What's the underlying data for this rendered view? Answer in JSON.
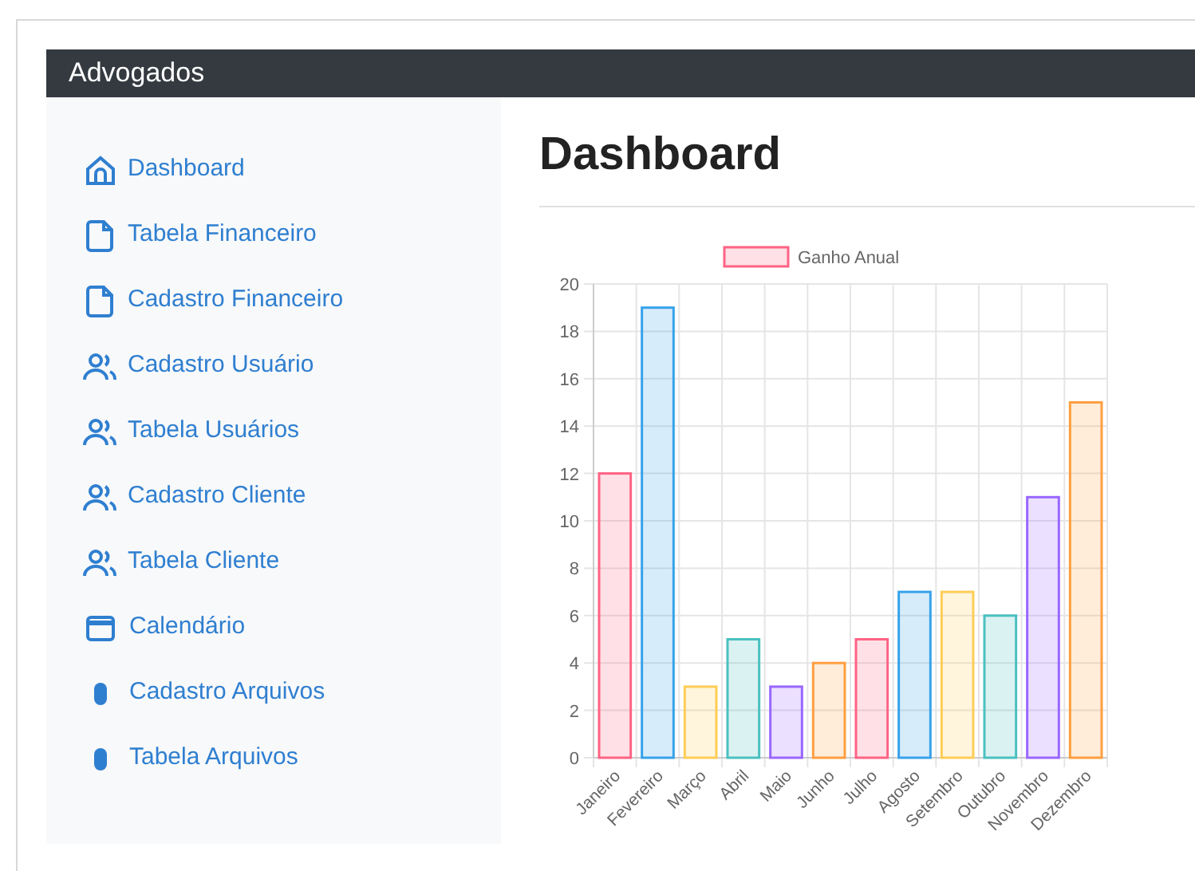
{
  "navbar": {
    "brand": "Advogados"
  },
  "sidebar": {
    "items": [
      {
        "label": "Dashboard",
        "kind": "home"
      },
      {
        "label": "Tabela Financeiro",
        "kind": "file"
      },
      {
        "label": "Cadastro Financeiro",
        "kind": "file"
      },
      {
        "label": "Cadastro Usuário",
        "kind": "people"
      },
      {
        "label": "Tabela Usuários",
        "kind": "people"
      },
      {
        "label": "Cadastro Cliente",
        "kind": "people"
      },
      {
        "label": "Tabela Cliente",
        "kind": "people"
      },
      {
        "label": "Calendário",
        "kind": "calendar"
      },
      {
        "label": "Cadastro Arquivos",
        "kind": "clip"
      },
      {
        "label": "Tabela Arquivos",
        "kind": "clip"
      }
    ]
  },
  "main": {
    "title": "Dashboard",
    "chart_data": {
      "type": "bar",
      "categories": [
        "Janeiro",
        "Fevereiro",
        "Março",
        "Abril",
        "Maio",
        "Junho",
        "Julho",
        "Agosto",
        "Setembro",
        "Outubro",
        "Novembro",
        "Dezembro"
      ],
      "series": [
        {
          "name": "Ganho Anual",
          "color": "#ff6384",
          "values": [
            12,
            19,
            3,
            5,
            3,
            4,
            5,
            7,
            7,
            6,
            11,
            15
          ],
          "colors": [
            "#ff6384",
            "#36a2eb",
            "#ffcd56",
            "#4bc0c0",
            "#9966ff",
            "#ff9f40",
            "#ff6384",
            "#36a2eb",
            "#ffcd56",
            "#4bc0c0",
            "#9966ff",
            "#ff9f40"
          ]
        }
      ],
      "grid": true,
      "ylim": [
        0,
        20
      ],
      "yticks": [
        0,
        2,
        4,
        6,
        8,
        10,
        12,
        14,
        16,
        18,
        20
      ]
    }
  }
}
